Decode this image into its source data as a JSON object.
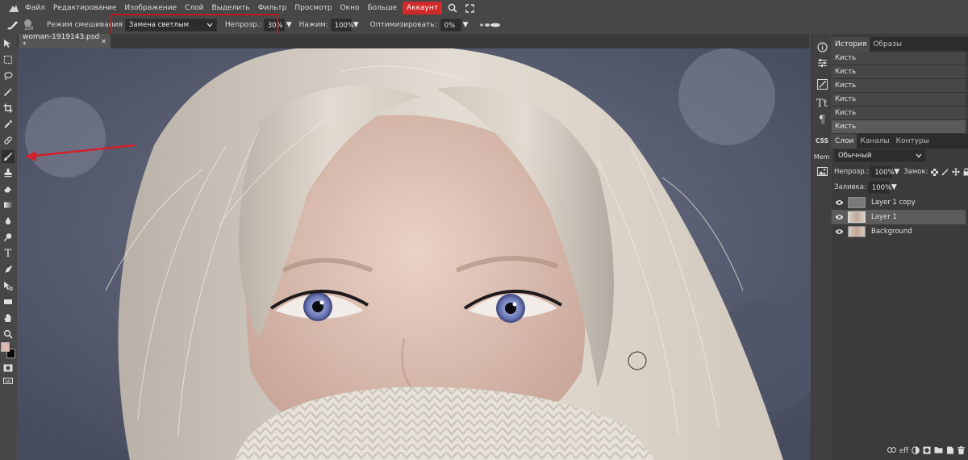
{
  "menu": {
    "items": [
      "Файл",
      "Редактирование",
      "Изображение",
      "Слой",
      "Выделить",
      "Фильтр",
      "Просмотр",
      "Окно",
      "Больше"
    ],
    "account_label": "Аккаунт",
    "account_color": "#cf2a2a"
  },
  "options": {
    "brush_size": "100",
    "blend_mode_label": "Режим смешивания",
    "blend_mode_value": "Замена светлым",
    "opacity_label": "Непрозр.:",
    "opacity_value": "30%",
    "pressure_label": "Нажим:",
    "pressure_value": "100%",
    "optimize_label": "Оптимизировать:",
    "optimize_value": "0%",
    "highlight_color": "#c0171c"
  },
  "document": {
    "tab_name": "woman-1919143.psd *",
    "close_glyph": "✕"
  },
  "icons": {
    "tools": [
      "move-icon",
      "marquee-icon",
      "lasso-icon",
      "magic-wand-icon",
      "crop-icon",
      "eyedropper-icon",
      "healing-icon",
      "brush-icon",
      "stamp-icon",
      "eraser-icon",
      "gradient-icon",
      "blur-icon",
      "dodge-icon",
      "type-icon",
      "pen-icon",
      "path-select-icon",
      "shape-icon",
      "hand-icon",
      "zoom-icon"
    ],
    "strip": [
      "info-icon",
      "adjustments-icon",
      "brush-settings-icon",
      "character-icon",
      "paragraph-icon",
      "css-icon",
      "memory-icon",
      "image-icon"
    ]
  },
  "strip_labels": {
    "css": "CSS",
    "mem": "Mem"
  },
  "history_panel": {
    "tabs": [
      "История",
      "Образы"
    ],
    "items": [
      "Кисть",
      "Кисть",
      "Кисть",
      "Кисть",
      "Кисть",
      "Кисть"
    ]
  },
  "layers_panel": {
    "tabs": [
      "Слои",
      "Каналы",
      "Контуры"
    ],
    "blend_mode": "Обычный",
    "opacity_label": "Непрозр.:",
    "opacity_value": "100%",
    "lock_label": "Замок:",
    "fill_label": "Заливка:",
    "fill_value": "100%",
    "layers": [
      {
        "name": "Layer 1 copy",
        "selected": false
      },
      {
        "name": "Layer 1",
        "selected": true
      },
      {
        "name": "Background",
        "selected": false
      }
    ],
    "footer_labels": [
      "eff"
    ]
  },
  "colors": {
    "foreground": "#d9b9b0",
    "background": "#0a0a0a",
    "annotation_arrow": "#d4202a"
  }
}
